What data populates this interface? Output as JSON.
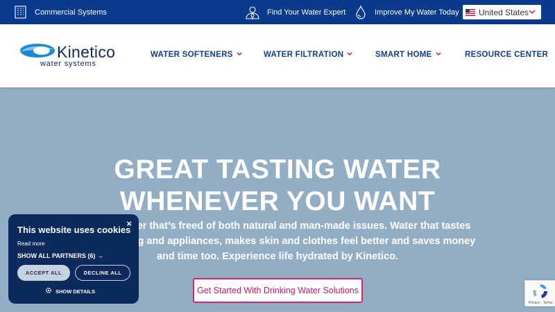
{
  "topbar": {
    "commercial": "Commercial Systems",
    "expert": "Find Your Water Expert",
    "improve": "Improve My Water Today",
    "country": "United States"
  },
  "logo": {
    "brand": "Kinetico",
    "tagline": "water systems"
  },
  "nav": {
    "softeners": "WATER SOFTENERS",
    "filtration": "WATER FILTRATION",
    "smart_home": "SMART HOME",
    "resources": "RESOURCE CENTER"
  },
  "hero": {
    "headline_1": "GREAT TASTING WATER",
    "headline_2": "WHENEVER YOU WANT",
    "body_1": "ed life. Water that’s freed of both natural and man-made issues. Water that tastes",
    "body_2": "our plumbing and appliances, makes skin and clothes feel better and saves money",
    "body_3": "and time too. Experience life hydrated by Kinetico.",
    "cta": "Get Started With Drinking Water Solutions"
  },
  "cookie": {
    "close": "×",
    "title": "This website uses cookies",
    "read_more": "Read more",
    "partners": "SHOW ALL PARTNERS (6) →",
    "accept": "ACCEPT ALL",
    "decline": "DECLINE ALL",
    "details": "SHOW DETAILS"
  },
  "recaptcha": {
    "text": "Privacy - Terms"
  },
  "colors": {
    "topbar": "#0a3a8c",
    "nav_text": "#123c8a",
    "accent": "#d0257b",
    "hero_bg": "#92aec5",
    "cookie_bg": "#0d2a5c"
  },
  "icons": [
    "building-icon",
    "expert-icon",
    "water-drop-icon",
    "us-flag-icon",
    "chevron-down-icon",
    "gear-icon",
    "recaptcha-icon"
  ]
}
